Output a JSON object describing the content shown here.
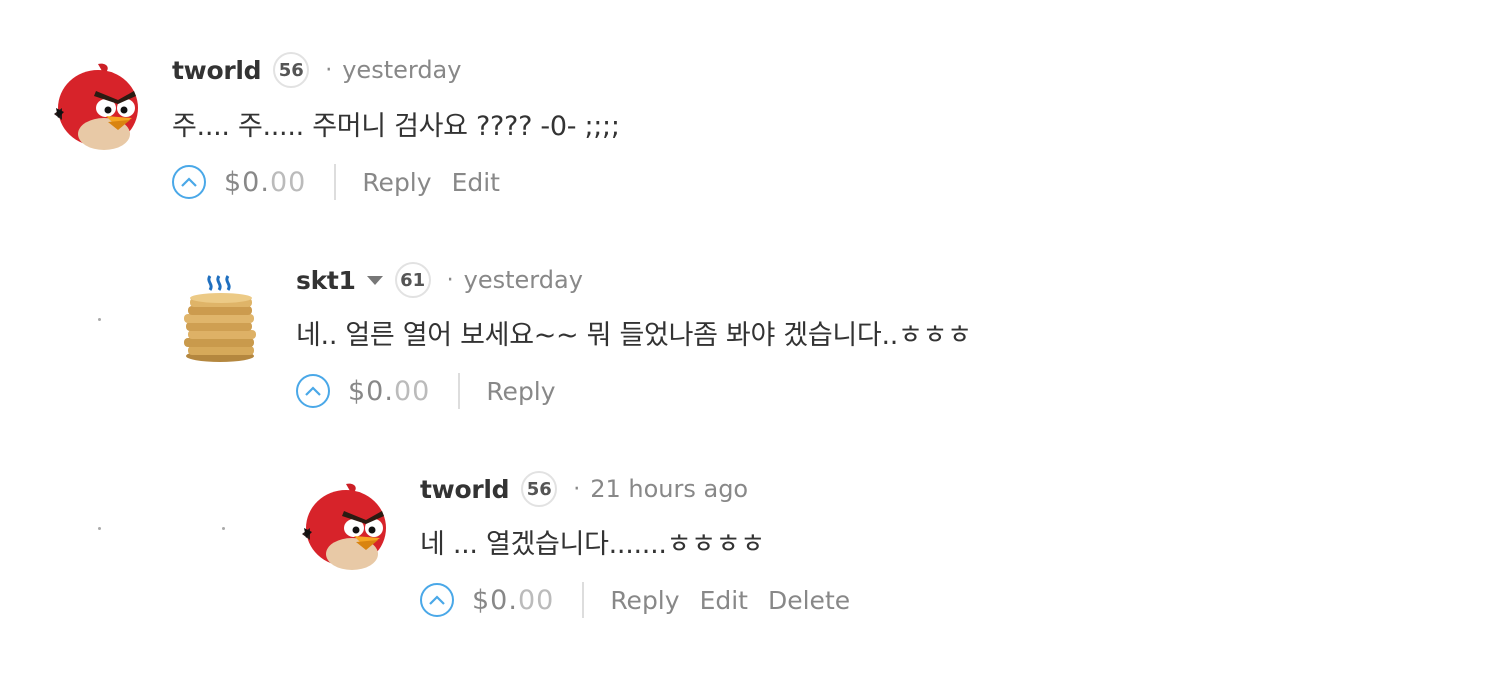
{
  "comments": [
    {
      "author": "tworld",
      "reputation": "56",
      "separator": "·",
      "time": "yesterday",
      "body": "주.... 주..... 주머니 검사요 ???? -0- ;;;;",
      "payout_main": "$0.",
      "payout_cents": "00",
      "actions": [
        "Reply",
        "Edit"
      ],
      "avatar_icon": "angry-bird-avatar-icon"
    },
    {
      "author": "skt1",
      "reputation": "61",
      "separator": "·",
      "time": "yesterday",
      "body": "네.. 얼른 열어 보세요~~ 뭐 들었나좀 봐야 겠습니다..ㅎㅎㅎ",
      "payout_main": "$0.",
      "payout_cents": "00",
      "actions": [
        "Reply"
      ],
      "avatar_icon": "coin-stack-avatar-icon"
    },
    {
      "author": "tworld",
      "reputation": "56",
      "separator": "·",
      "time": "21 hours ago",
      "body": "네 ... 열겠습니다.......ㅎㅎㅎㅎ",
      "payout_main": "$0.",
      "payout_cents": "00",
      "actions": [
        "Reply",
        "Edit",
        "Delete"
      ],
      "avatar_icon": "angry-bird-avatar-icon"
    }
  ],
  "colors": {
    "text": "#333333",
    "muted": "#888888",
    "vote_accent": "#4aa8e8",
    "separator": "#dddddd"
  },
  "icons": {
    "vote": "upvote-chevron-icon",
    "expand": "caret-down-icon"
  }
}
